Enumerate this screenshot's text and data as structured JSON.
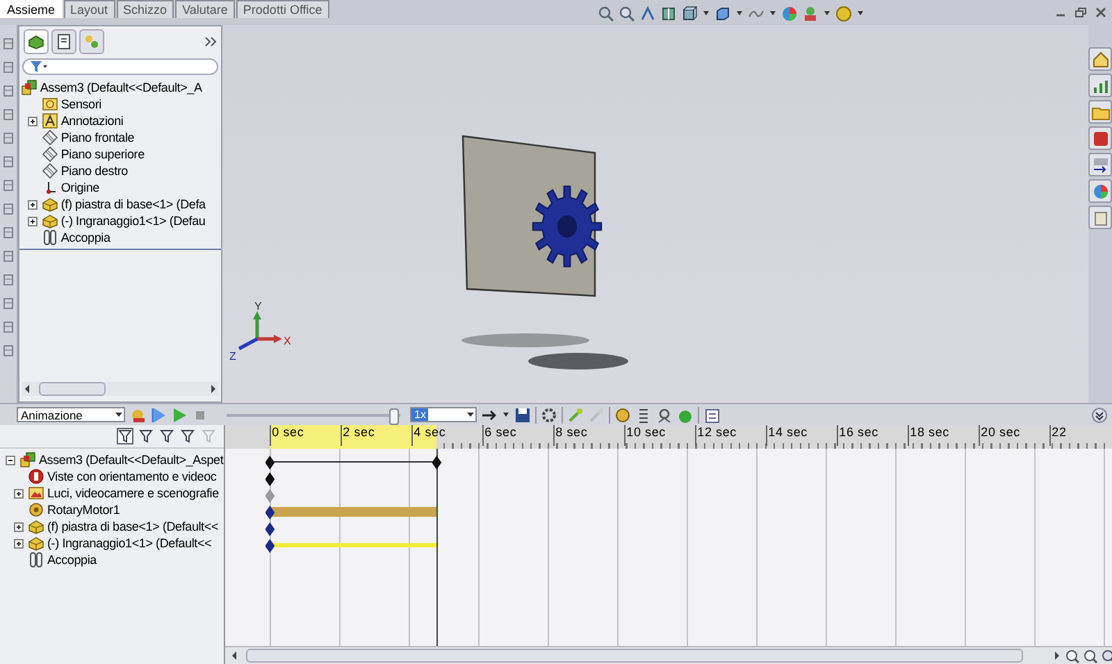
{
  "tabs": [
    {
      "label": "Assieme",
      "selected": true
    },
    {
      "label": "Layout",
      "selected": false
    },
    {
      "label": "Schizzo",
      "selected": false
    },
    {
      "label": "Valutare",
      "selected": false
    },
    {
      "label": "Prodotti Office",
      "selected": false
    }
  ],
  "feature_tree": {
    "items": [
      {
        "label": "Assem3  (Default<<Default>_A",
        "kind": "assembly",
        "expandable": false,
        "children": [
          {
            "label": "Sensori",
            "kind": "sensor",
            "expandable": false
          },
          {
            "label": "Annotazioni",
            "kind": "annotation",
            "expandable": true,
            "expanded": false
          },
          {
            "label": "Piano frontale",
            "kind": "plane",
            "expandable": false
          },
          {
            "label": "Piano superiore",
            "kind": "plane",
            "expandable": false
          },
          {
            "label": "Piano destro",
            "kind": "plane",
            "expandable": false
          },
          {
            "label": "Origine",
            "kind": "origin",
            "expandable": false
          },
          {
            "label": "(f) piastra di base<1> (Defa",
            "kind": "part",
            "expandable": true,
            "expanded": false
          },
          {
            "label": "(-) Ingranaggio1<1> (Defau",
            "kind": "part",
            "expandable": true,
            "expanded": false
          },
          {
            "label": "Accoppia",
            "kind": "mates",
            "expandable": false
          }
        ]
      }
    ]
  },
  "viewport": {
    "triad": {
      "x": "X",
      "y": "Y",
      "z": "Z"
    }
  },
  "animation": {
    "study_type": "Animazione",
    "slider": {
      "level": 0.96
    },
    "speed": "1x",
    "ruler_labels": [
      "0 sec",
      "2 sec",
      "4 sec",
      "6 sec",
      "8 sec",
      "10 sec",
      "12 sec",
      "14 sec",
      "16 sec",
      "18 sec",
      "20 sec",
      "22"
    ],
    "tree": [
      {
        "label": "Assem3  (Default<<Default>_Aspet",
        "kind": "assembly",
        "expandable": true,
        "expanded": true,
        "track": {
          "kind": "span",
          "color": "#111111"
        },
        "children": [
          {
            "label": "Viste con orientamento e videoc",
            "kind": "view",
            "expandable": false,
            "track": {
              "kind": "key",
              "color": "#111111"
            }
          },
          {
            "label": "Luci, videocamere e scenografie",
            "kind": "lights",
            "expandable": true,
            "expanded": false,
            "track": {
              "kind": "key",
              "color": "#9a9a9a"
            }
          },
          {
            "label": "RotaryMotor1",
            "kind": "motor",
            "expandable": false,
            "track": {
              "kind": "bar",
              "color": "#1c2a8a",
              "bar": {
                "color": "#c8a44c"
              }
            }
          },
          {
            "label": "(f) piastra di base<1> (Default<<",
            "kind": "part",
            "expandable": true,
            "expanded": false,
            "track": {
              "kind": "key",
              "color": "#1c2a8a"
            }
          },
          {
            "label": "(-) Ingranaggio1<1> (Default<<",
            "kind": "part",
            "expandable": true,
            "expanded": false,
            "track": {
              "kind": "line",
              "color": "#1c2a8a",
              "bar": {
                "color": "#f2ee3a"
              }
            }
          },
          {
            "label": "Accoppia",
            "kind": "mates",
            "expandable": false,
            "track": {
              "kind": "none"
            }
          }
        ]
      }
    ]
  }
}
